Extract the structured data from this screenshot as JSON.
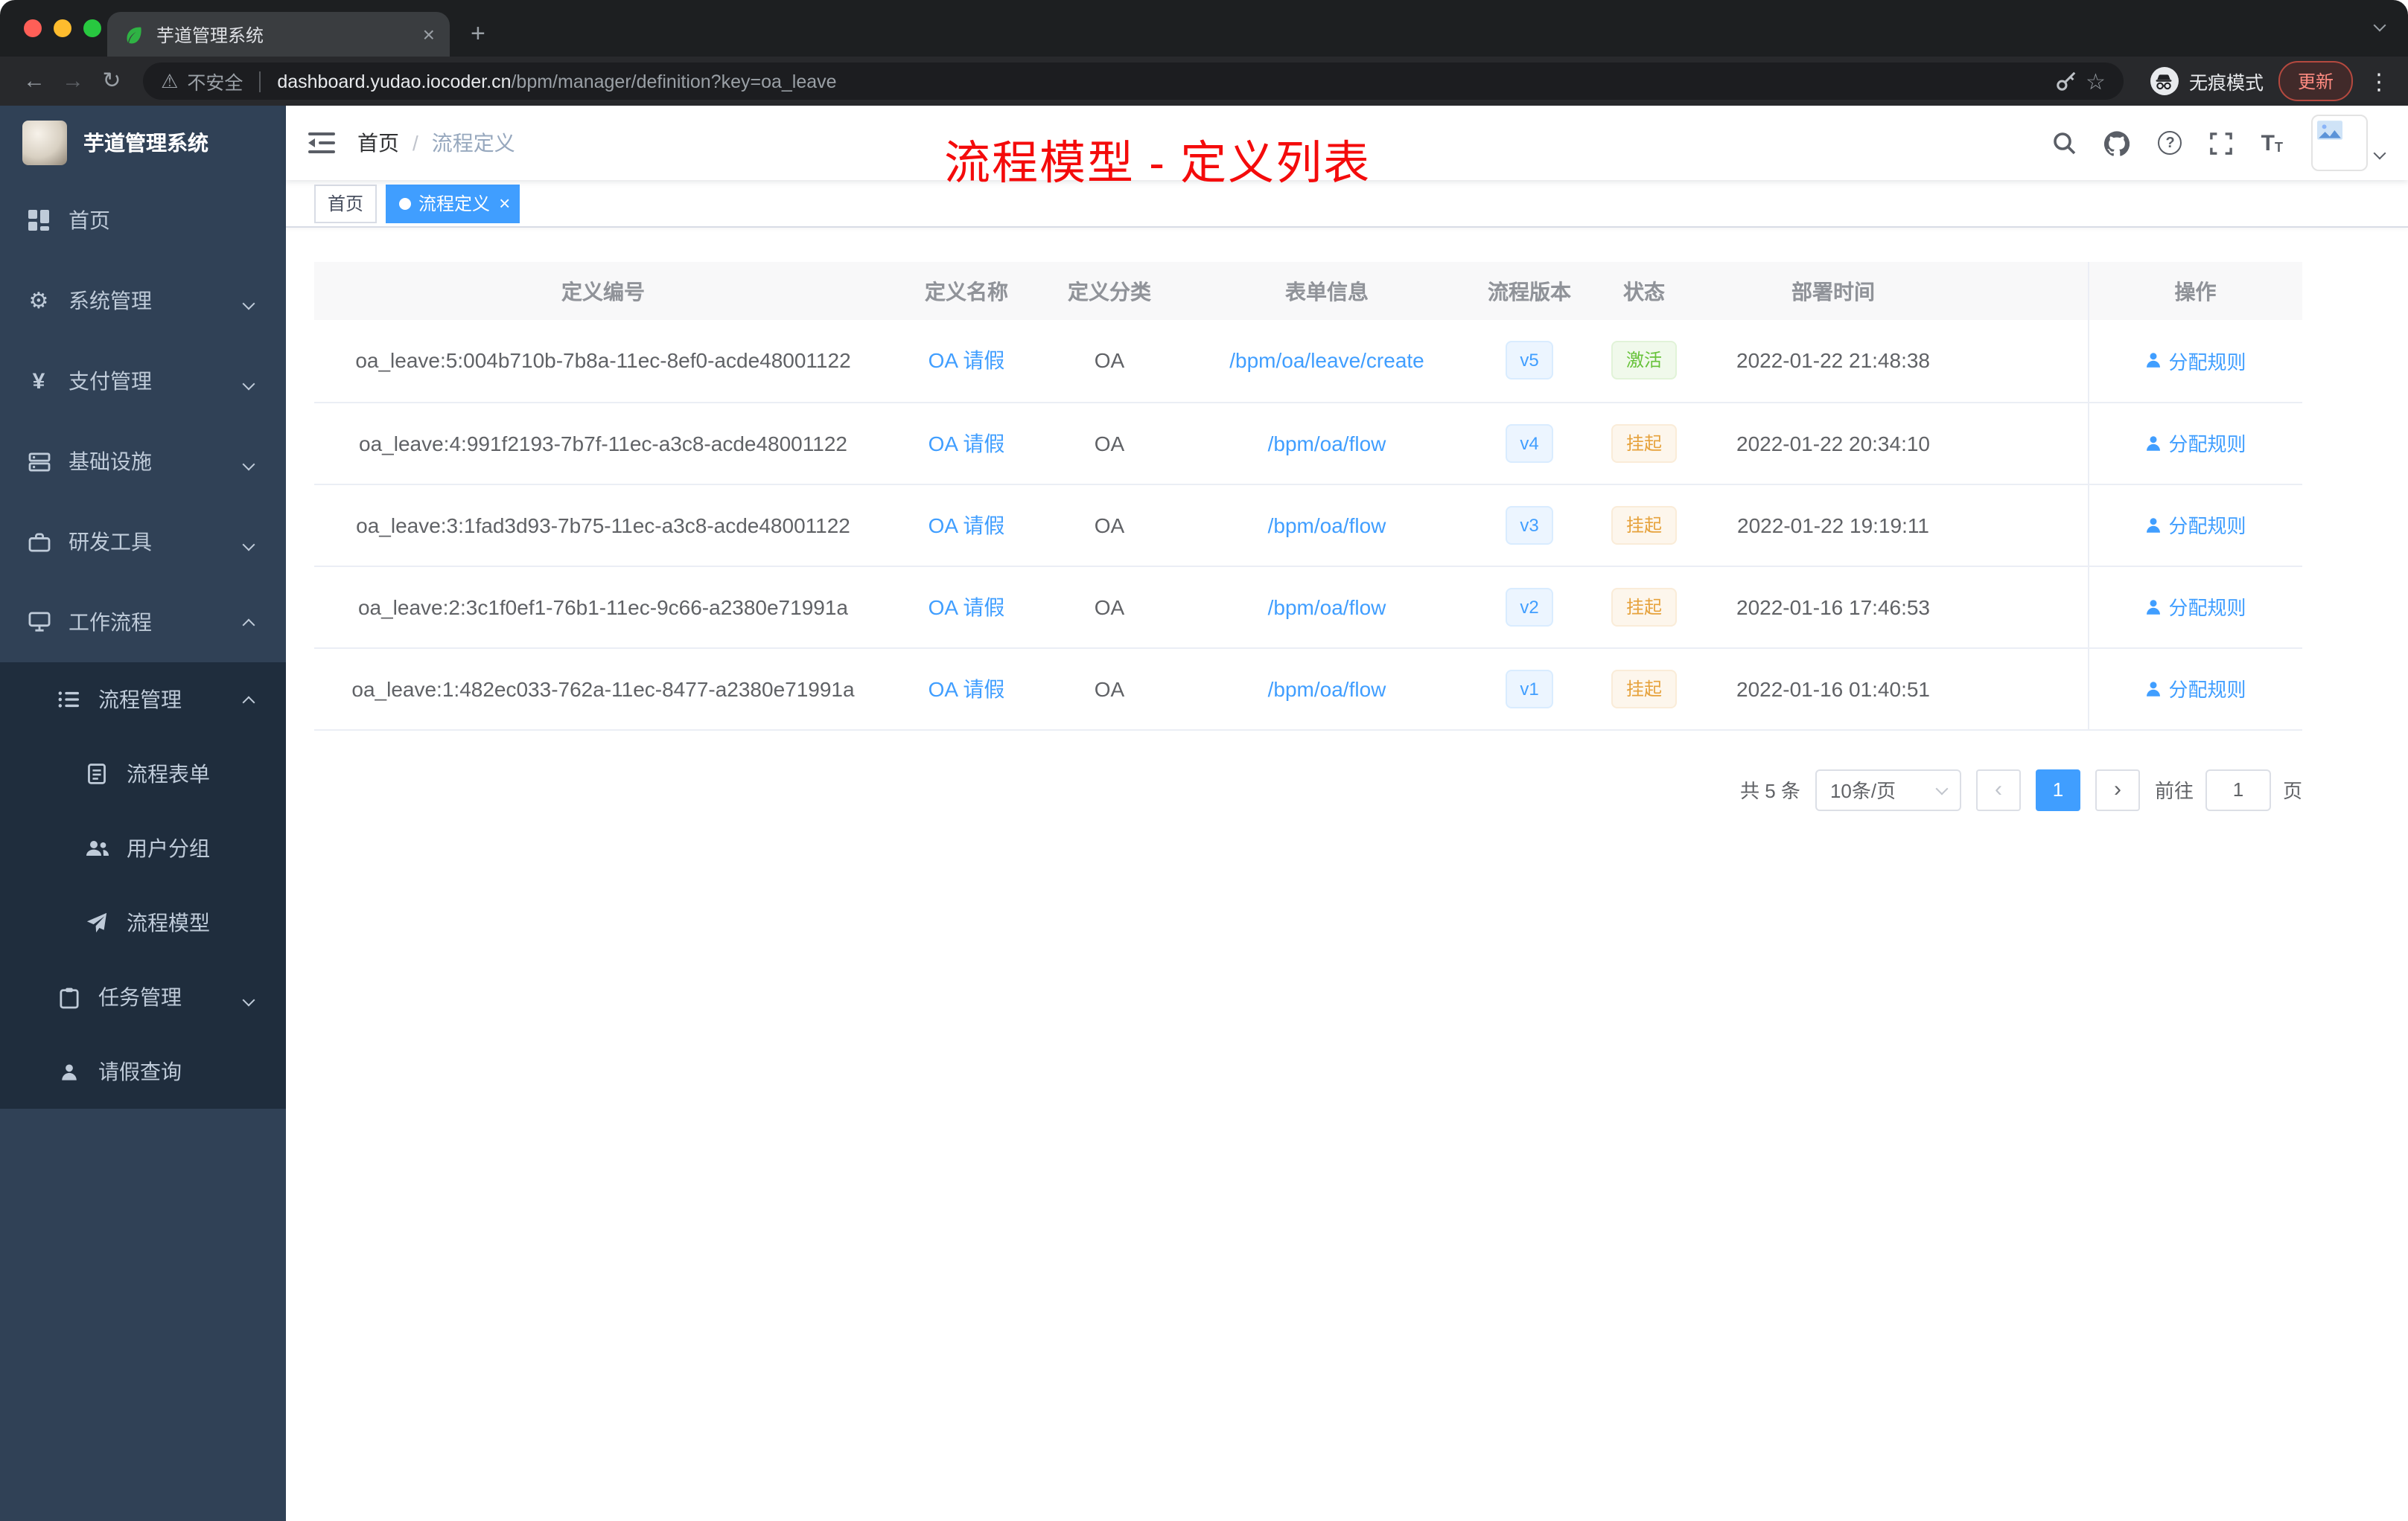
{
  "browser": {
    "tab": {
      "title": "芋道管理系统"
    },
    "address": {
      "security_label": "不安全",
      "domain": "dashboard.yudao.iocoder.cn",
      "path": "/bpm/manager/definition?key=oa_leave"
    },
    "incognito_label": "无痕模式",
    "update_label": "更新"
  },
  "icons": {
    "back": "←",
    "forward": "→",
    "reload": "↻",
    "warning": "⚠",
    "star": "☆",
    "close": "×",
    "new_tab": "+",
    "menu_dots": "⋮",
    "question": "?",
    "font_size": "T",
    "gear": "⚙",
    "yen": "¥"
  },
  "sidebar": {
    "title": "芋道管理系统",
    "items": [
      {
        "label": "首页"
      },
      {
        "label": "系统管理"
      },
      {
        "label": "支付管理"
      },
      {
        "label": "基础设施"
      },
      {
        "label": "研发工具"
      },
      {
        "label": "工作流程"
      },
      {
        "label": "流程管理"
      },
      {
        "label": "流程表单"
      },
      {
        "label": "用户分组"
      },
      {
        "label": "流程模型"
      },
      {
        "label": "任务管理"
      },
      {
        "label": "请假查询"
      }
    ]
  },
  "header": {
    "breadcrumb": {
      "home": "首页",
      "separator": "/",
      "current": "流程定义"
    }
  },
  "annotation": "流程模型 - 定义列表",
  "tags": {
    "items": [
      {
        "label": "首页"
      },
      {
        "label": "流程定义"
      }
    ]
  },
  "table": {
    "columns": {
      "id": "定义编号",
      "name": "定义名称",
      "category": "定义分类",
      "form": "表单信息",
      "version": "流程版本",
      "status": "状态",
      "deploy_time": "部署时间",
      "actions": "操作"
    },
    "rows": [
      {
        "id": "oa_leave:5:004b710b-7b8a-11ec-8ef0-acde48001122",
        "name": "OA 请假",
        "category": "OA",
        "form": "/bpm/oa/leave/create",
        "version": "v5",
        "status": "激活",
        "deploy_time": "2022-01-22 21:48:38",
        "action": "分配规则"
      },
      {
        "id": "oa_leave:4:991f2193-7b7f-11ec-a3c8-acde48001122",
        "name": "OA 请假",
        "category": "OA",
        "form": "/bpm/oa/flow",
        "version": "v4",
        "status": "挂起",
        "deploy_time": "2022-01-22 20:34:10",
        "action": "分配规则"
      },
      {
        "id": "oa_leave:3:1fad3d93-7b75-11ec-a3c8-acde48001122",
        "name": "OA 请假",
        "category": "OA",
        "form": "/bpm/oa/flow",
        "version": "v3",
        "status": "挂起",
        "deploy_time": "2022-01-22 19:19:11",
        "action": "分配规则"
      },
      {
        "id": "oa_leave:2:3c1f0ef1-76b1-11ec-9c66-a2380e71991a",
        "name": "OA 请假",
        "category": "OA",
        "form": "/bpm/oa/flow",
        "version": "v2",
        "status": "挂起",
        "deploy_time": "2022-01-16 17:46:53",
        "action": "分配规则"
      },
      {
        "id": "oa_leave:1:482ec033-762a-11ec-8477-a2380e71991a",
        "name": "OA 请假",
        "category": "OA",
        "form": "/bpm/oa/flow",
        "version": "v1",
        "status": "挂起",
        "deploy_time": "2022-01-16 01:40:51",
        "action": "分配规则"
      }
    ]
  },
  "pagination": {
    "total": "共 5 条",
    "page_size": "10条/页",
    "prev": "‹",
    "next": "›",
    "current_page": "1",
    "goto_label": "前往",
    "goto_value": "1",
    "page_unit": "页"
  },
  "colors": {
    "accent": "#409eff",
    "success": "#67c23a",
    "warning": "#e6a23c",
    "sidebar_bg": "#304156",
    "submenu_bg": "#1f2d3d",
    "annotation_red": "#f40b0b"
  }
}
